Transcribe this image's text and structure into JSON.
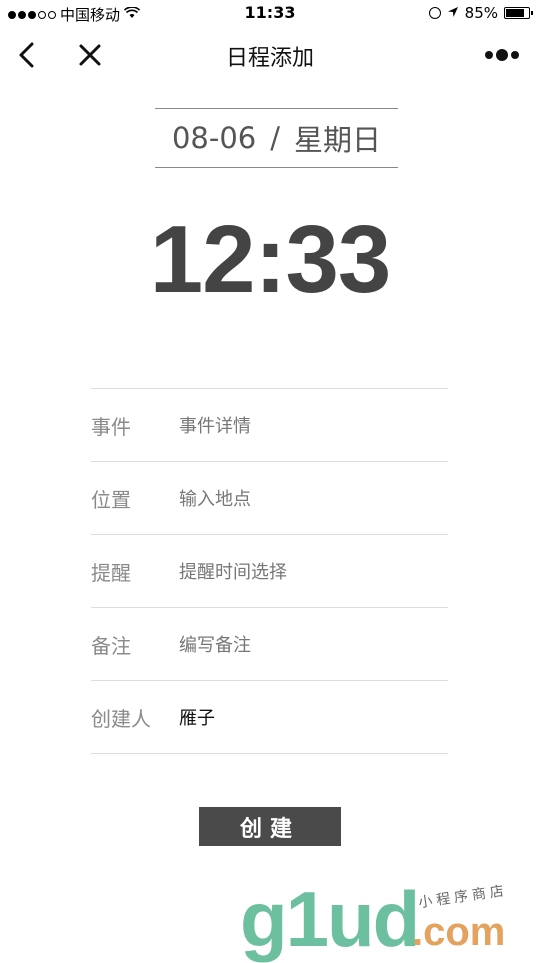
{
  "status_bar": {
    "carrier": "中国移动",
    "time": "11:33",
    "battery": "85%",
    "battery_level": 0.85
  },
  "nav": {
    "title": "日程添加"
  },
  "date": {
    "day": "08-06",
    "separator": "/",
    "weekday": "星期日"
  },
  "time": "12:33",
  "form": {
    "rows": [
      {
        "label": "事件",
        "value": "事件详情",
        "placeholder": true
      },
      {
        "label": "位置",
        "value": "输入地点",
        "placeholder": true
      },
      {
        "label": "提醒",
        "value": "提醒时间选择",
        "placeholder": true
      },
      {
        "label": "备注",
        "value": "编写备注",
        "placeholder": true
      },
      {
        "label": "创建人",
        "value": "雁子",
        "placeholder": false
      }
    ]
  },
  "create_label": "创建",
  "watermark": {
    "main": "g1ud",
    "domain": ".com",
    "sub": "小程序商店"
  },
  "colors": {
    "button_bg": "#4a4a4a",
    "watermark_green": "#6cc0a0",
    "watermark_orange": "#e3a35e"
  }
}
